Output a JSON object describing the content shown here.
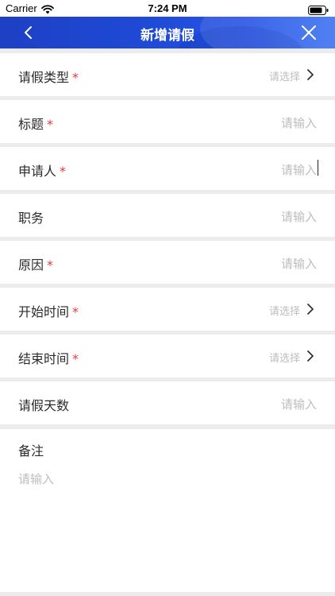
{
  "status_bar": {
    "carrier": "Carrier",
    "time": "7:24 PM"
  },
  "nav": {
    "title": "新增请假",
    "back_icon": "chevron-left-icon",
    "close_icon": "close-icon"
  },
  "colors": {
    "nav_gradient_start": "#1d40c4",
    "nav_gradient_end": "#3d73f2",
    "required_star": "#e0393e",
    "placeholder": "#bdbdbd",
    "background": "#ececec"
  },
  "form": {
    "rows": [
      {
        "label": "请假类型",
        "required": "*",
        "placeholder": "请选择",
        "kind": "select"
      },
      {
        "label": "标题",
        "required": "*",
        "placeholder": "请输入",
        "kind": "input"
      },
      {
        "label": "申请人",
        "required": "*",
        "placeholder": "请输入",
        "kind": "input"
      },
      {
        "label": "职务",
        "required": "",
        "placeholder": "请输入",
        "kind": "input"
      },
      {
        "label": "原因",
        "required": "*",
        "placeholder": "请输入",
        "kind": "input"
      },
      {
        "label": "开始时间",
        "required": "*",
        "placeholder": "请选择",
        "kind": "select"
      },
      {
        "label": "结束时间",
        "required": "*",
        "placeholder": "请选择",
        "kind": "select"
      },
      {
        "label": "请假天数",
        "required": "",
        "placeholder": "请输入",
        "kind": "input"
      }
    ],
    "remarks": {
      "label": "备注",
      "placeholder": "请输入"
    }
  }
}
